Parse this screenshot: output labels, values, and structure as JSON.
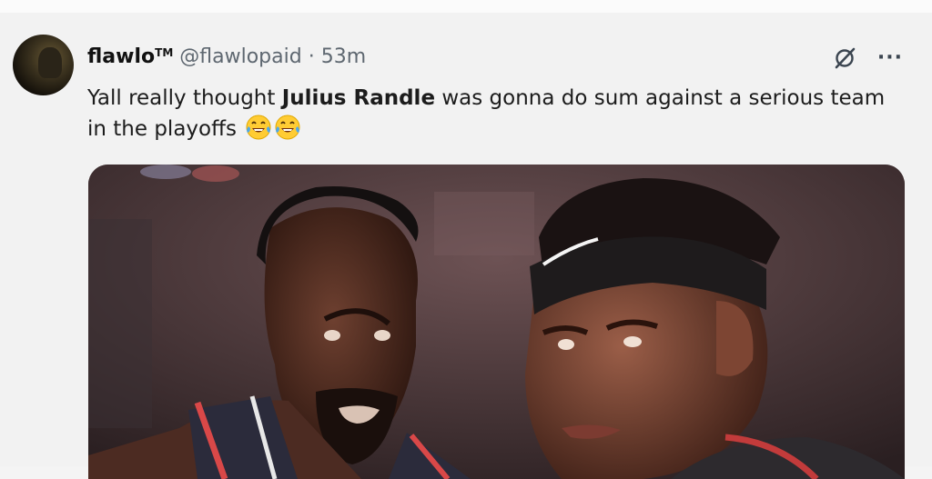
{
  "tweet": {
    "display_name": "flawlo",
    "tm": "TM",
    "handle": "@flawlopaid",
    "separator": "·",
    "time": "53m",
    "text_before": "Yall really thought ",
    "text_bold": "Julius Randle",
    "text_after": " was gonna do sum against a serious team in the playoffs",
    "emojis": [
      "face-with-tears-of-joy",
      "face-with-tears-of-joy"
    ]
  },
  "icons": {
    "grok": "grok-icon",
    "more": "more-icon",
    "more_glyph": "···"
  },
  "colors": {
    "name": "#111111",
    "meta": "#5e6770",
    "text": "#1c1c1c",
    "background": "#f2f2f2"
  }
}
